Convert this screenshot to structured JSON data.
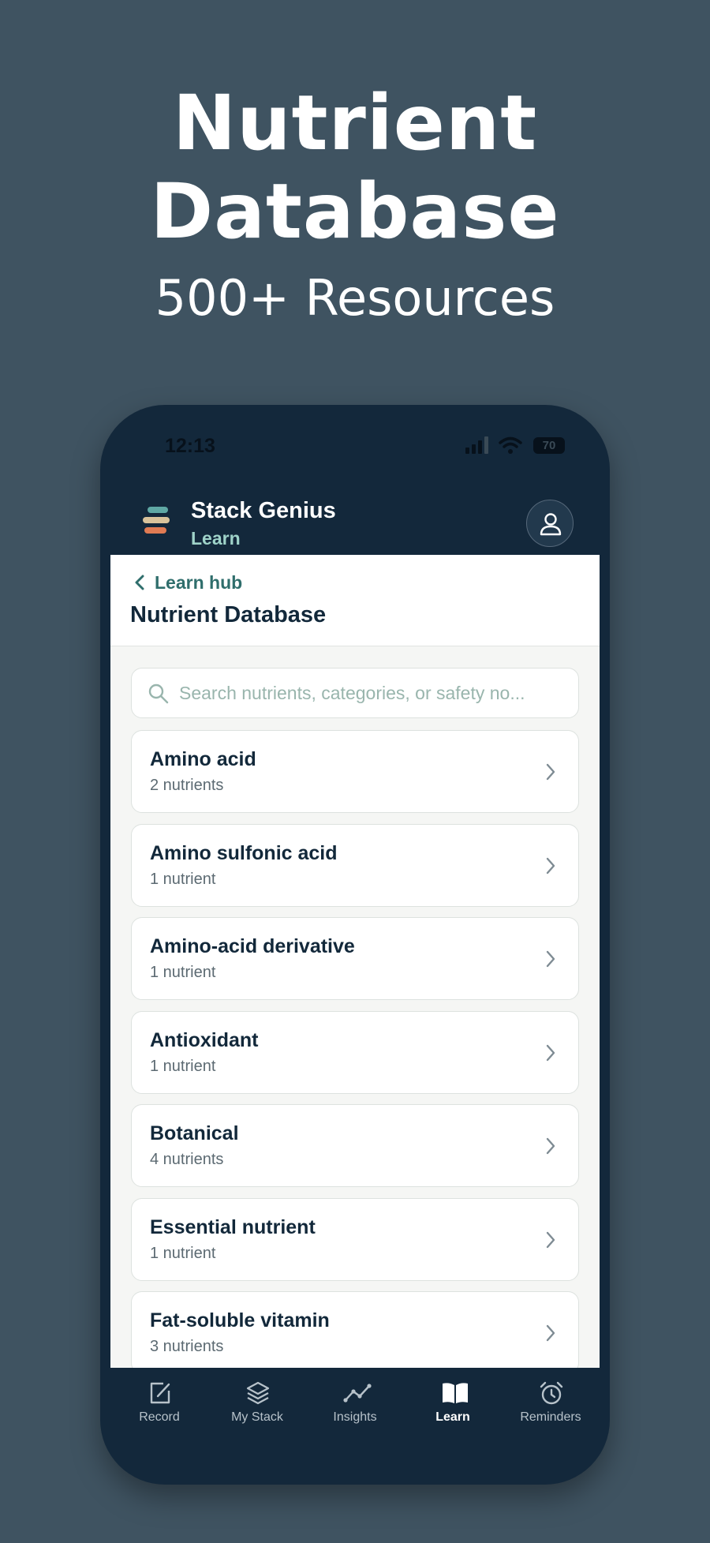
{
  "hero": {
    "title_line1": "Nutrient",
    "title_line2": "Database",
    "subtitle": "500+ Resources"
  },
  "status_bar": {
    "time": "12:13",
    "battery": "70"
  },
  "app_header": {
    "app_name": "Stack Genius",
    "section": "Learn",
    "icons": {
      "logo": "stacked-bars-logo",
      "profile": "user-icon"
    }
  },
  "page": {
    "back_label": "Learn hub",
    "title": "Nutrient Database"
  },
  "search": {
    "value": "",
    "placeholder": "Search nutrients, categories, or safety no..."
  },
  "categories": [
    {
      "name": "Amino acid",
      "count": "2 nutrients"
    },
    {
      "name": "Amino sulfonic acid",
      "count": "1 nutrient"
    },
    {
      "name": "Amino-acid derivative",
      "count": "1 nutrient"
    },
    {
      "name": "Antioxidant",
      "count": "1 nutrient"
    },
    {
      "name": "Botanical",
      "count": "4 nutrients"
    },
    {
      "name": "Essential nutrient",
      "count": "1 nutrient"
    },
    {
      "name": "Fat-soluble vitamin",
      "count": "3 nutrients"
    }
  ],
  "tabs": [
    {
      "label": "Record",
      "icon": "edit-icon",
      "active": false
    },
    {
      "label": "My Stack",
      "icon": "layers-icon",
      "active": false
    },
    {
      "label": "Insights",
      "icon": "trend-line-icon",
      "active": false
    },
    {
      "label": "Learn",
      "icon": "book-icon",
      "active": true
    },
    {
      "label": "Reminders",
      "icon": "alarm-clock-icon",
      "active": false
    }
  ],
  "colors": {
    "background": "#3f5361",
    "phone": "#13283b",
    "accent": "#2f6e6c",
    "section_accent": "#9fd3c9",
    "logo_teal": "#5fa8a4",
    "logo_sand": "#d9c39b",
    "logo_orange": "#e07b53"
  }
}
